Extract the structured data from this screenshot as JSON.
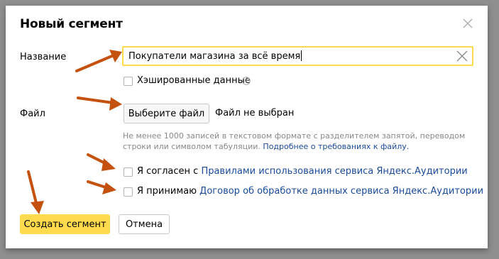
{
  "dialog": {
    "title": "Новый сегмент",
    "close_icon": "close-icon"
  },
  "form": {
    "name_label": "Название",
    "name_value": "Покупатели магазина за всё время",
    "hashed_label": "Хэшированные данные",
    "file_label": "Файл",
    "file_button": "Выберите файл",
    "file_status": "Файл не выбран",
    "hint_text": "Не менее 1000 записей в текстовом формате с разделителем запятой, переводом строки или символом табуляции.",
    "hint_link": "Подробнее о требованиях к файлу.",
    "agree1_prefix": "Я согласен с",
    "agree1_link": "Правилами использования сервиса Яндекс.Аудитории",
    "agree2_prefix": "Я принимаю",
    "agree2_link": "Договор об обработке данных сервиса Яндекс.Аудитории"
  },
  "buttons": {
    "create": "Создать сегмент",
    "cancel": "Отмена"
  },
  "colors": {
    "accent": "#ffdb4d",
    "link": "#1a4a99",
    "annotation_arrow": "#c4510e"
  }
}
